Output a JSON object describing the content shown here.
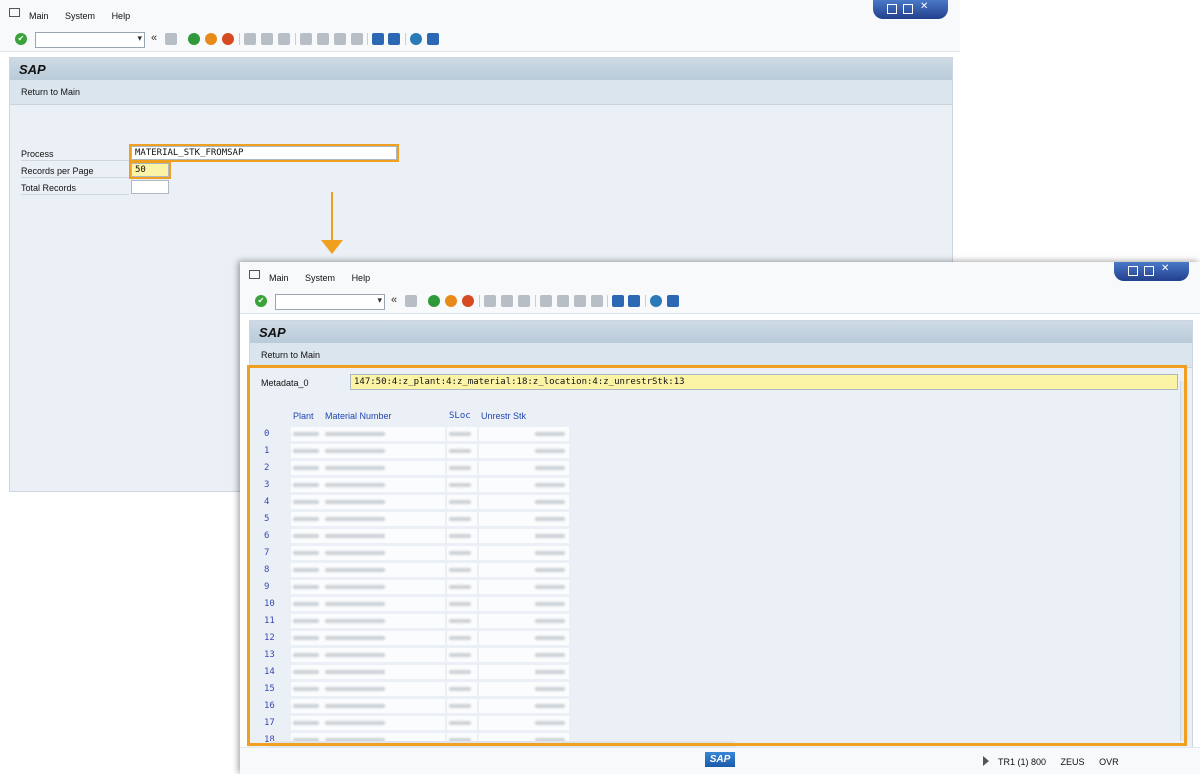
{
  "menu": [
    "Main",
    "System",
    "Help"
  ],
  "screen": {
    "title": "SAP",
    "return_button": "Return to Main"
  },
  "form": {
    "process_label": "Process",
    "process_value": "MATERIAL_STK_FROMSAP",
    "records_label": "Records per Page",
    "records_value": "50",
    "total_label": "Total Records",
    "total_value": ""
  },
  "result": {
    "metadata_label": "Metadata_0",
    "metadata_value": "147:50:4:z_plant:4:z_material:18:z_location:4:z_unrestrStk:13",
    "columns": [
      "Plant",
      "Material Number",
      "SLoc",
      "Unrestr Stk"
    ],
    "row_numbers": [
      "0",
      "1",
      "2",
      "3",
      "4",
      "5",
      "6",
      "7",
      "8",
      "9",
      "10",
      "11",
      "12",
      "13",
      "14",
      "15",
      "16",
      "17",
      "18"
    ]
  },
  "statusbar": {
    "logo": "SAP",
    "session": "TR1 (1) 800",
    "server": "ZEUS",
    "mode": "OVR"
  },
  "colors": {
    "highlight": "#f0a020",
    "header_bar": "#b9cad9",
    "table_header_text": "#2246b0"
  }
}
